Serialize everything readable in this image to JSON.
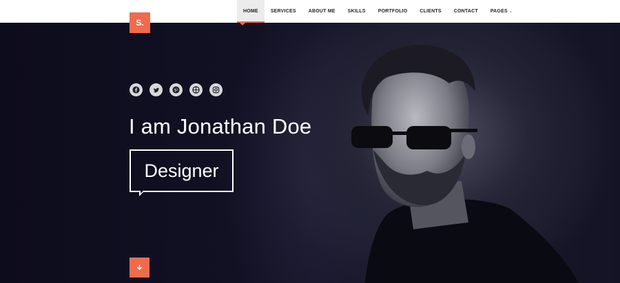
{
  "brand": {
    "logo_text": "S.",
    "accent": "#ee6c4d"
  },
  "nav": {
    "items": [
      {
        "label": "HOME",
        "active": true
      },
      {
        "label": "SERVICES"
      },
      {
        "label": "ABOUT ME"
      },
      {
        "label": "SKILLS"
      },
      {
        "label": "PORTFOLIO"
      },
      {
        "label": "CLIENTS"
      },
      {
        "label": "CONTACT"
      },
      {
        "label": "PAGES",
        "has_dropdown": true
      }
    ],
    "dropdown_caret": "⌄"
  },
  "hero": {
    "headline": "I am Jonathan Doe",
    "role": "Designer",
    "socials": [
      "facebook-icon",
      "twitter-icon",
      "pinterest-icon",
      "dribbble-icon",
      "instagram-icon"
    ],
    "scroll_icon": "arrow-down-icon"
  }
}
